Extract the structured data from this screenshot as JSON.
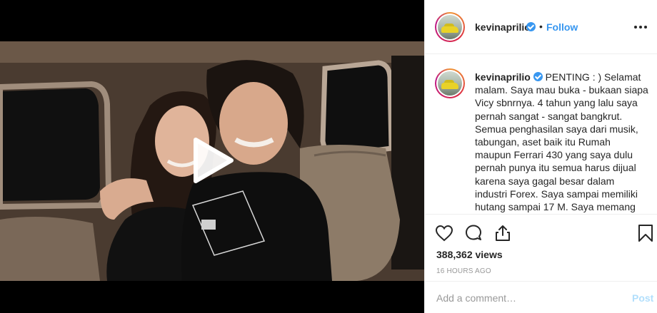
{
  "media": {
    "type": "video",
    "play_icon": "play-icon"
  },
  "post": {
    "username": "kevinaprilio",
    "verified": true,
    "follow_label": "Follow",
    "separator": "•",
    "more_icon": "more-horizontal-icon",
    "caption_username": "kevinaprilio",
    "caption_text": "PENTING : ) Selamat malam. Saya mau buka - bukaan siapa Vicy sbnrnya. 4 tahun yang lalu saya pernah sangat - sangat bangkrut. Semua penghasilan saya dari musik, tabungan, aset baik itu Rumah maupun Ferrari 430 yang saya dulu pernah punya itu semua harus dijual karena saya gagal besar dalam industri Forex. Saya sampai memiliki hutang sampai 17 M. Saya memang tidak",
    "views": "388,362 views",
    "timestamp": "16 HOURS AGO"
  },
  "actions": {
    "like_icon": "heart-icon",
    "comment_icon": "comment-icon",
    "share_icon": "share-icon",
    "save_icon": "bookmark-icon"
  },
  "comment": {
    "placeholder": "Add a comment…",
    "post_label": "Post"
  },
  "colors": {
    "accent": "#3897f0",
    "post_disabled": "#b2dffc",
    "text": "#262626",
    "muted": "#999999",
    "border": "#efefef"
  }
}
